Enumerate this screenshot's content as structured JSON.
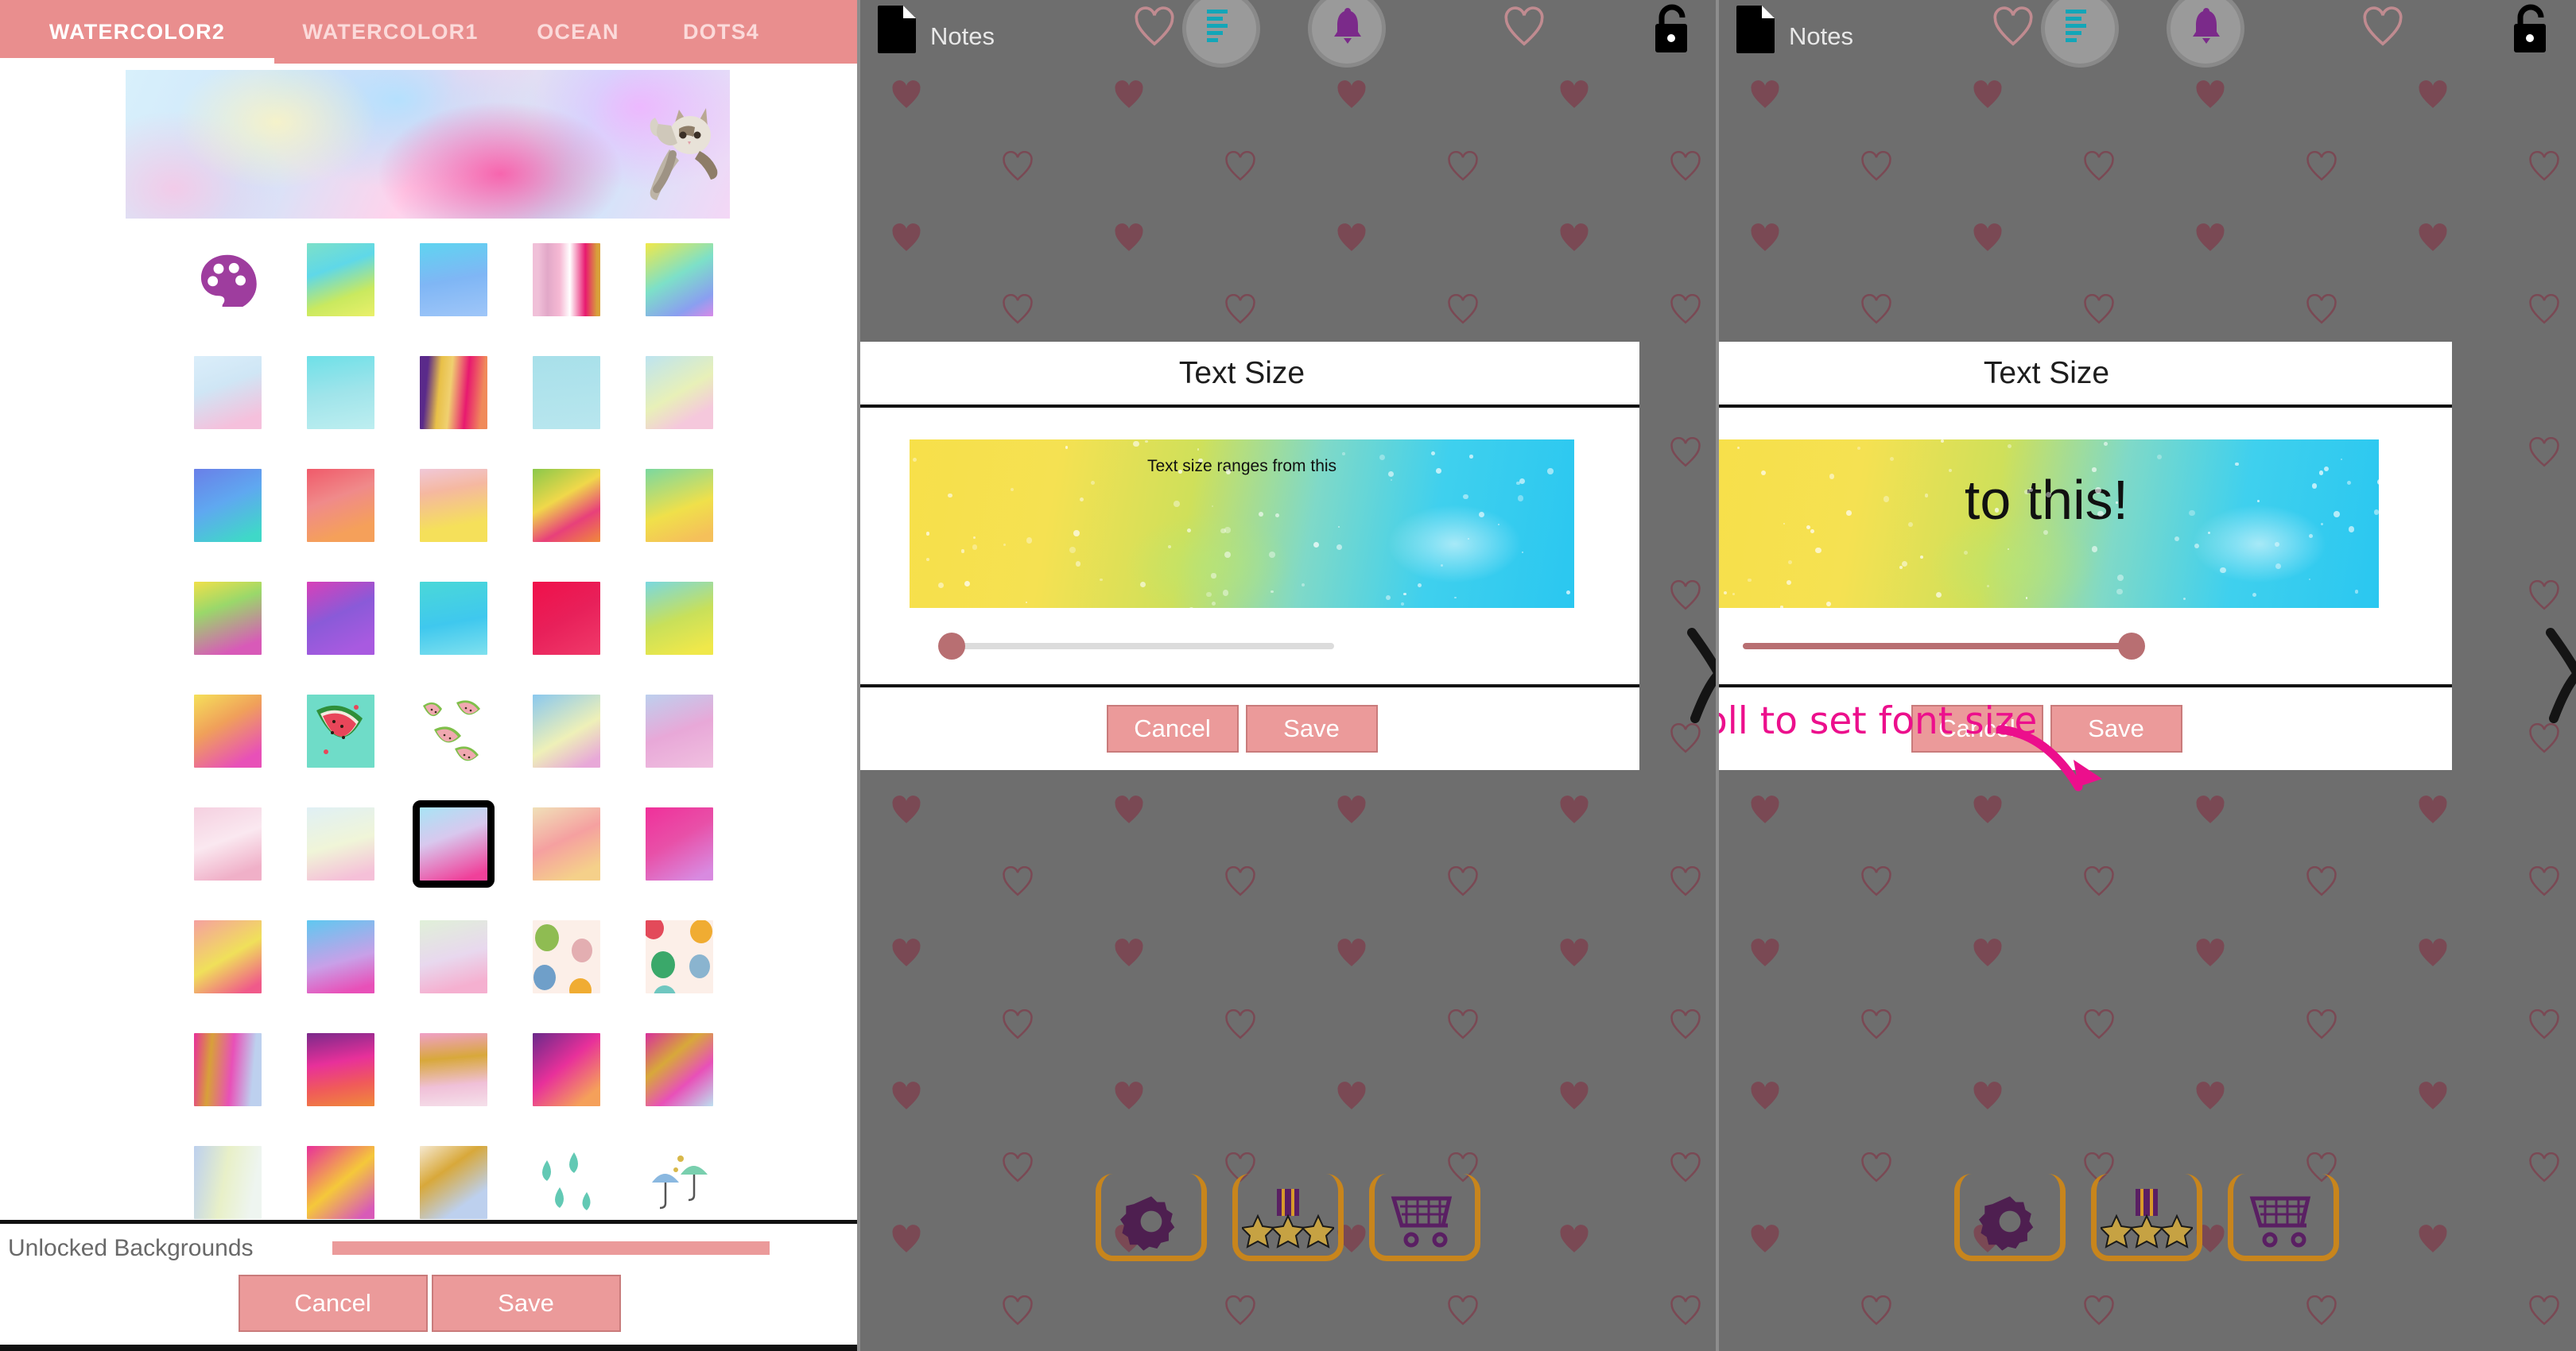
{
  "background_picker": {
    "tabs": [
      {
        "label": "WATERCOLOR2",
        "active": true
      },
      {
        "label": "WATERCOLOR1",
        "active": false
      },
      {
        "label": "OCEAN",
        "active": false
      },
      {
        "label": "DOTS4",
        "active": false
      }
    ],
    "preview": {
      "name": "banner-preview",
      "sticker": "cat-sticker"
    },
    "palette_icon": "palette-icon",
    "selected_thumbnail": {
      "row": 7,
      "column": 3,
      "index": 31
    },
    "thumbnail_rows": 9,
    "thumbnail_columns": 5,
    "progress": {
      "label": "Unlocked Backgrounds",
      "percent": 100
    },
    "cancel_label": "Cancel",
    "save_label": "Save"
  },
  "text_size_dialog_small": {
    "title": "Text Size",
    "sample_text": "Text size ranges from this",
    "sample_font_px": 21,
    "slider_value_percent": 2,
    "cancel_label": "Cancel",
    "save_label": "Save"
  },
  "text_size_dialog_large": {
    "title": "Text Size",
    "sample_text": "to this!",
    "sample_font_px": 70,
    "slider_value_percent": 100,
    "cancel_label": "Cancel",
    "save_label": "Save",
    "annotation": "Scroll to set font size"
  },
  "app_chrome": {
    "notes_label": "Notes",
    "doc_icon": "document-icon",
    "list_icon": "list-lines-icon",
    "bell_icon": "bell-icon",
    "lock_icon": "unlock-icon",
    "bottom_icons": [
      "settings-gear-icon",
      "rate-stars-icon",
      "shopping-cart-icon"
    ]
  },
  "colors": {
    "accent_pink": "#eb9a9a",
    "tab_bar": "#e98e8e",
    "annotation_magenta": "#ec0f8c",
    "dim_overlay": "#6e6e6e",
    "slider_knob": "#b86f72",
    "icon_purple": "#6d2a6d",
    "icon_gold": "#c8851c"
  }
}
